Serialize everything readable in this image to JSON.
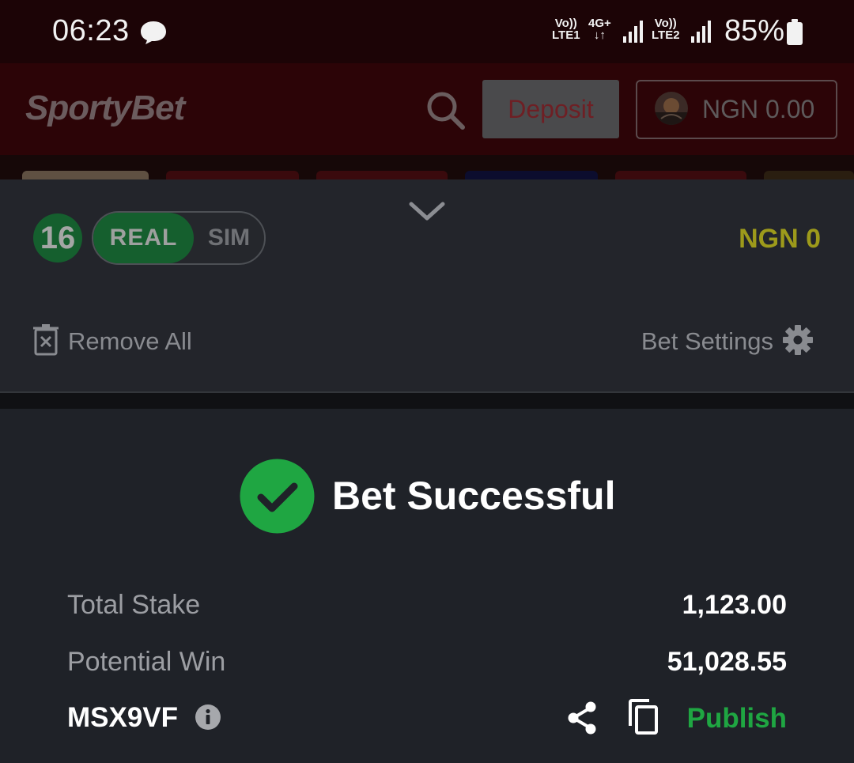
{
  "status_bar": {
    "time": "06:23",
    "sim1": {
      "volte": "Vo))",
      "type": "LTE1"
    },
    "network": {
      "type": "4G+",
      "activity": "↓↑"
    },
    "sim2": {
      "volte": "Vo))",
      "type": "LTE2"
    },
    "battery": "85%"
  },
  "header": {
    "logo": "SportyBet",
    "deposit_label": "Deposit",
    "balance": "NGN 0.00"
  },
  "betslip": {
    "count": "16",
    "mode_real": "REAL",
    "mode_sim": "SIM",
    "total": "NGN 0",
    "remove_all": "Remove All",
    "bet_settings": "Bet Settings"
  },
  "result": {
    "title": "Bet Successful",
    "total_stake_label": "Total Stake",
    "total_stake": "1,123.00",
    "potential_win_label": "Potential Win",
    "potential_win": "51,028.55",
    "booking_code": "MSX9VF",
    "publish_label": "Publish"
  },
  "colors": {
    "success_green": "#1fa642",
    "accent_yellow": "#9d9a1b",
    "header_red": "#2c0407"
  }
}
